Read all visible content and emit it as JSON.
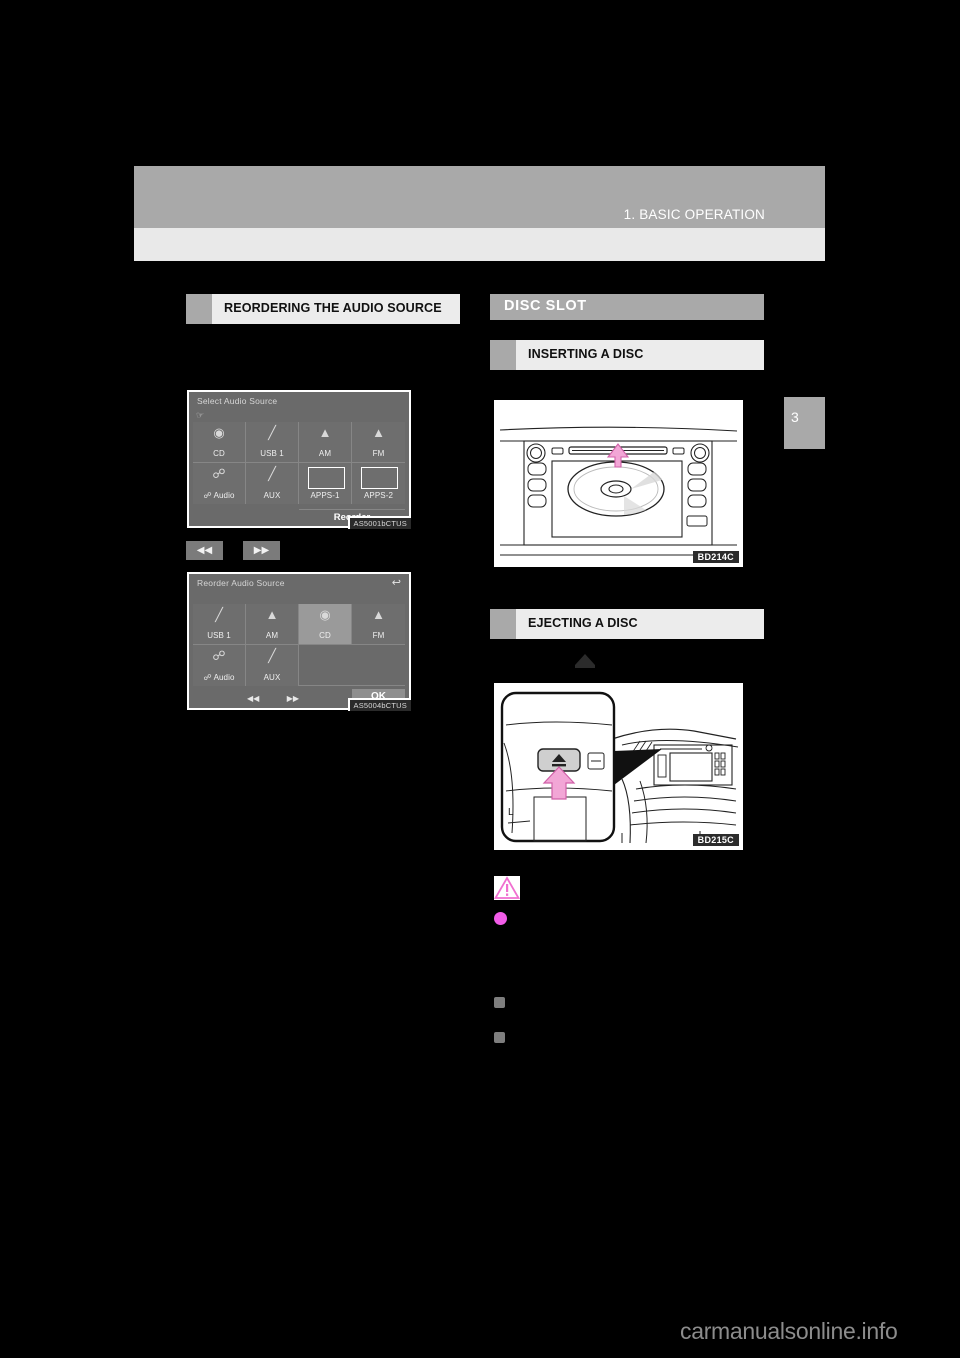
{
  "header": {
    "title": "1. BASIC OPERATION",
    "chapter_number": "3"
  },
  "left_column": {
    "heading": "REORDERING THE AUDIO SOURCE",
    "screen1": {
      "title": "Select Audio Source",
      "hand_icon": "hand-pointer-icon",
      "image_code": "AS5001bCTUS",
      "buttons": [
        {
          "label": "CD",
          "icon": "cd-disc-icon"
        },
        {
          "label": "USB 1",
          "icon": "usb-stick-icon"
        },
        {
          "label": "AM",
          "icon": "radio-tower-icon"
        },
        {
          "label": "FM",
          "icon": "radio-tower-icon"
        },
        {
          "label": "Audio",
          "icon": "bluetooth-icon"
        },
        {
          "label": "AUX",
          "icon": "aux-plug-icon"
        },
        {
          "label": "APPS-1",
          "icon": "app-box-icon"
        },
        {
          "label": "APPS-2",
          "icon": "app-box-icon"
        }
      ],
      "reorder_label": "Reorder"
    },
    "seek_buttons": [
      {
        "name": "seek-back-button",
        "glyph": "◀◀"
      },
      {
        "name": "seek-forward-button",
        "glyph": "▶▶"
      }
    ],
    "screen2": {
      "title": "Reorder Audio Source",
      "back_icon": "back-arrow-icon",
      "image_code": "AS5004bCTUS",
      "buttons": [
        {
          "label": "USB 1",
          "icon": "usb-stick-icon",
          "selected": false
        },
        {
          "label": "AM",
          "icon": "radio-tower-icon",
          "selected": false
        },
        {
          "label": "CD",
          "icon": "cd-disc-icon",
          "selected": true
        },
        {
          "label": "FM",
          "icon": "radio-tower-icon",
          "selected": false
        },
        {
          "label": "Audio",
          "icon": "bluetooth-icon",
          "selected": false
        },
        {
          "label": "AUX",
          "icon": "aux-plug-icon",
          "selected": false
        }
      ],
      "move_left_glyph": "◀◀",
      "move_right_glyph": "▶▶",
      "ok_label": "OK"
    }
  },
  "right_column": {
    "banner": "DISC SLOT",
    "inserting": {
      "heading": "INSERTING A DISC",
      "figure_code": "BD214C",
      "figure_name": "head-unit-disc-slot-illustration"
    },
    "ejecting": {
      "heading": "EJECTING A DISC",
      "eject_symbol": "eject-triangle-icon",
      "figure_code": "BD215C",
      "figure_name": "dashboard-eject-button-illustration"
    },
    "notices": {
      "caution_icon": "caution-triangle-icon",
      "pink_bullet": "warning-bullet",
      "gray_bullets": [
        "note-bullet-1",
        "note-bullet-2"
      ]
    }
  },
  "footer": {
    "watermark": "carmanualsonline.info"
  },
  "colors": {
    "band_gray": "#a9a9a9",
    "subband_gray": "#e9e9e9",
    "subhead_bg": "#ececec",
    "accent_pink": "#f08fd0",
    "screen_bg": "#6a6a6a",
    "selected_cell": "#9a9a9a",
    "watermark": "#8c8c8c"
  }
}
